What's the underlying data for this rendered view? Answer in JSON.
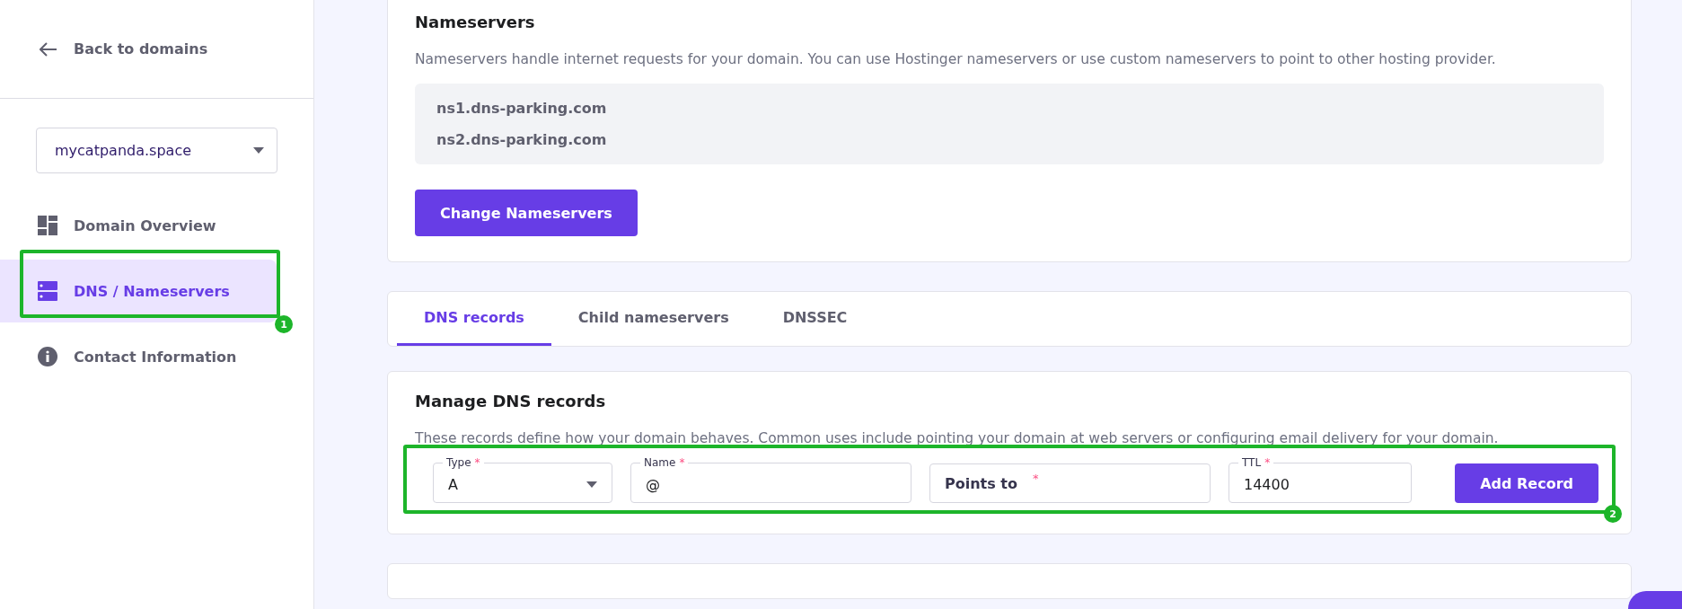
{
  "sidebar": {
    "back_link": "Back to domains",
    "domain_select": {
      "value": "mycatpanda.space"
    },
    "items": [
      {
        "label": "Domain Overview",
        "selected": false
      },
      {
        "label": "DNS / Nameservers",
        "selected": true
      },
      {
        "label": "Contact Information",
        "selected": false
      }
    ]
  },
  "nameservers": {
    "title": "Nameservers",
    "description": "Nameservers handle internet requests for your domain. You can use Hostinger nameservers or use custom nameservers to point to other hosting provider.",
    "servers": [
      "ns1.dns-parking.com",
      "ns2.dns-parking.com"
    ],
    "button": "Change Nameservers"
  },
  "tabs": [
    {
      "label": "DNS records",
      "selected": true
    },
    {
      "label": "Child nameservers",
      "selected": false
    },
    {
      "label": "DNSSEC",
      "selected": false
    }
  ],
  "manage": {
    "title": "Manage DNS records",
    "description": "These records define how your domain behaves. Common uses include pointing your domain at web servers or configuring email delivery for your domain.",
    "required_mark": "*",
    "fields": [
      {
        "kind": "select",
        "label": "Type",
        "required": true,
        "value": "A"
      },
      {
        "kind": "text",
        "label": "Name",
        "required": true,
        "value": "@"
      },
      {
        "kind": "text",
        "placeholder": "Points to",
        "required": true
      },
      {
        "kind": "text",
        "label": "TTL",
        "required": true,
        "value": "14400"
      }
    ],
    "button": "Add Record"
  },
  "annotations": [
    {
      "label": "1"
    },
    {
      "label": "2"
    }
  ]
}
